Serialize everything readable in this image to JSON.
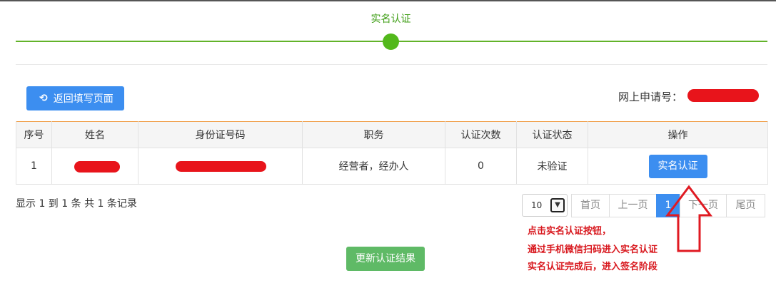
{
  "step": {
    "title": "实名认证"
  },
  "actions": {
    "back_label": "返回填写页面",
    "back_icon": "undo-icon",
    "update_label": "更新认证结果"
  },
  "application": {
    "label": "网上申请号："
  },
  "table": {
    "headers": [
      "序号",
      "姓名",
      "身份证号码",
      "职务",
      "认证次数",
      "认证状态",
      "操作"
    ],
    "rows": [
      {
        "index": "1",
        "role": "经营者，经办人",
        "count": "0",
        "status": "未验证",
        "action": "实名认证"
      }
    ]
  },
  "pagination": {
    "summary": "显示 1 到 1 条 共 1 条记录",
    "page_size": "10",
    "first": "首页",
    "prev": "上一页",
    "current": "1",
    "next": "下一页",
    "last": "尾页"
  },
  "annotation": {
    "lines": [
      "点击实名认证按钮，",
      "通过手机微信扫码进入实名认证",
      "实名认证完成后，进入签名阶段"
    ]
  },
  "colors": {
    "primary": "#3c8ef0",
    "success": "#5fba66",
    "step_green": "#52b81b",
    "annotation_red": "#d8171d"
  }
}
